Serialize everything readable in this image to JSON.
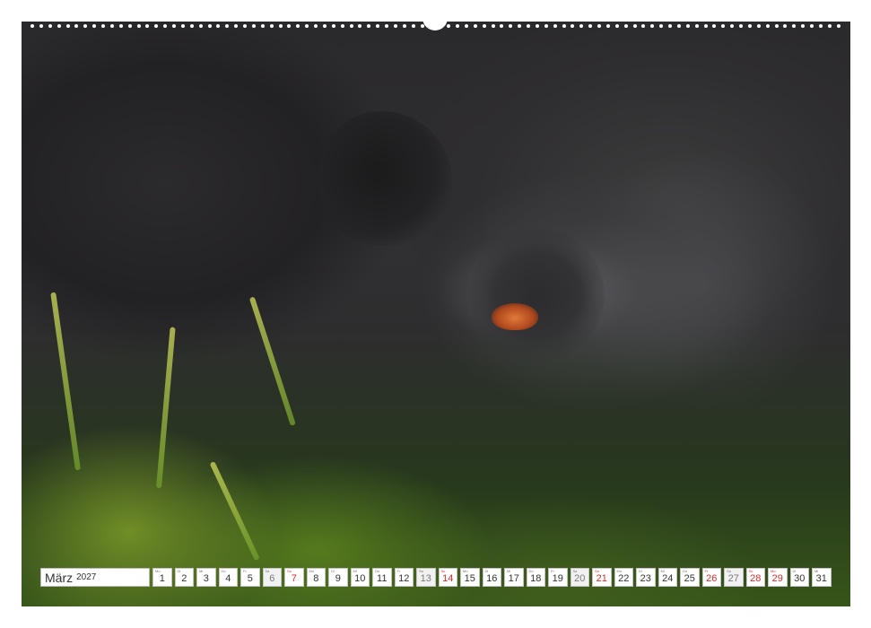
{
  "calendar": {
    "month": "März",
    "year": "2027",
    "days": [
      {
        "n": "1",
        "d": "Mo",
        "k": "normal"
      },
      {
        "n": "2",
        "d": "Di",
        "k": "normal"
      },
      {
        "n": "3",
        "d": "Mi",
        "k": "normal"
      },
      {
        "n": "4",
        "d": "Do",
        "k": "normal"
      },
      {
        "n": "5",
        "d": "Fr",
        "k": "normal"
      },
      {
        "n": "6",
        "d": "Sa",
        "k": "gray"
      },
      {
        "n": "7",
        "d": "So",
        "k": "red"
      },
      {
        "n": "8",
        "d": "Mo",
        "k": "normal"
      },
      {
        "n": "9",
        "d": "Di",
        "k": "normal"
      },
      {
        "n": "10",
        "d": "Mi",
        "k": "normal"
      },
      {
        "n": "11",
        "d": "Do",
        "k": "normal"
      },
      {
        "n": "12",
        "d": "Fr",
        "k": "normal"
      },
      {
        "n": "13",
        "d": "Sa",
        "k": "gray"
      },
      {
        "n": "14",
        "d": "So",
        "k": "red"
      },
      {
        "n": "15",
        "d": "Mo",
        "k": "normal"
      },
      {
        "n": "16",
        "d": "Di",
        "k": "normal"
      },
      {
        "n": "17",
        "d": "Mi",
        "k": "normal"
      },
      {
        "n": "18",
        "d": "Do",
        "k": "normal"
      },
      {
        "n": "19",
        "d": "Fr",
        "k": "normal"
      },
      {
        "n": "20",
        "d": "Sa",
        "k": "gray"
      },
      {
        "n": "21",
        "d": "So",
        "k": "red"
      },
      {
        "n": "22",
        "d": "Mo",
        "k": "normal"
      },
      {
        "n": "23",
        "d": "Di",
        "k": "normal"
      },
      {
        "n": "24",
        "d": "Mi",
        "k": "normal"
      },
      {
        "n": "25",
        "d": "Do",
        "k": "normal"
      },
      {
        "n": "26",
        "d": "Fr",
        "k": "red"
      },
      {
        "n": "27",
        "d": "Sa",
        "k": "gray"
      },
      {
        "n": "28",
        "d": "So",
        "k": "red"
      },
      {
        "n": "29",
        "d": "Mo",
        "k": "red"
      },
      {
        "n": "30",
        "d": "Di",
        "k": "normal"
      },
      {
        "n": "31",
        "d": "Mi",
        "k": "normal"
      }
    ]
  },
  "colors": {
    "holiday_red": "#d62b2b",
    "weekend_gray": "#f1f1f1"
  }
}
